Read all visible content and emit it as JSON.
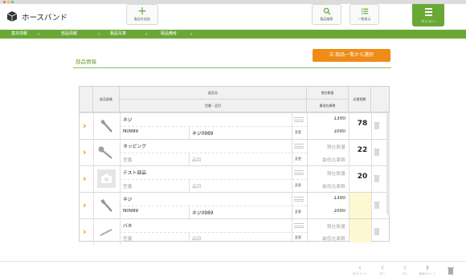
{
  "app": {
    "title": "ホースバンド"
  },
  "header": {
    "add_part_label": "製品を追加",
    "search_label": "製品検索",
    "list_label": "一覧表示",
    "menu_label": "メニュー"
  },
  "nav": [
    "基本情報",
    "部品情報",
    "製品写真",
    "製品備考"
  ],
  "section": {
    "title": "部品情報",
    "select_button": "部品一覧から選択"
  },
  "table": {
    "headers": {
      "image": "部品画像",
      "name": "部品名",
      "model_item": "型番・品目",
      "current_qty": "現在数量",
      "min_stock": "最低在庫数",
      "required": "必要個数"
    },
    "change_label": "変更",
    "rows": [
      {
        "name": "ネジ",
        "model": "N0989",
        "item": "ネジ0989",
        "current": "1300",
        "min": "1000",
        "count": "78",
        "image": "screw-icon"
      },
      {
        "name": "タッピング",
        "model": "型番",
        "item": "品目",
        "current": "現在数量",
        "min": "最低在庫数",
        "count": "22",
        "image": "tapping-screw-icon"
      },
      {
        "name": "テスト部品",
        "model": "型番",
        "item": "品目",
        "current": "現在数量",
        "min": "最低在庫数",
        "count": "20",
        "image": "camera-icon"
      },
      {
        "name": "ネジ",
        "model": "N0989",
        "item": "ネジ0989",
        "current": "1300",
        "min": "1000",
        "count": "",
        "image": "screw-icon"
      },
      {
        "name": "バネ",
        "model": "型番",
        "item": "品目",
        "current": "現在数量",
        "min": "最低在庫数",
        "count": "",
        "image": "spring-icon"
      }
    ]
  },
  "footer": {
    "labels": [
      "前のページ",
      "前へ",
      "次へ",
      "最後のページ",
      "削除"
    ]
  },
  "colors": {
    "accent_green": "#6aa836",
    "accent_orange": "#ef8c16"
  }
}
